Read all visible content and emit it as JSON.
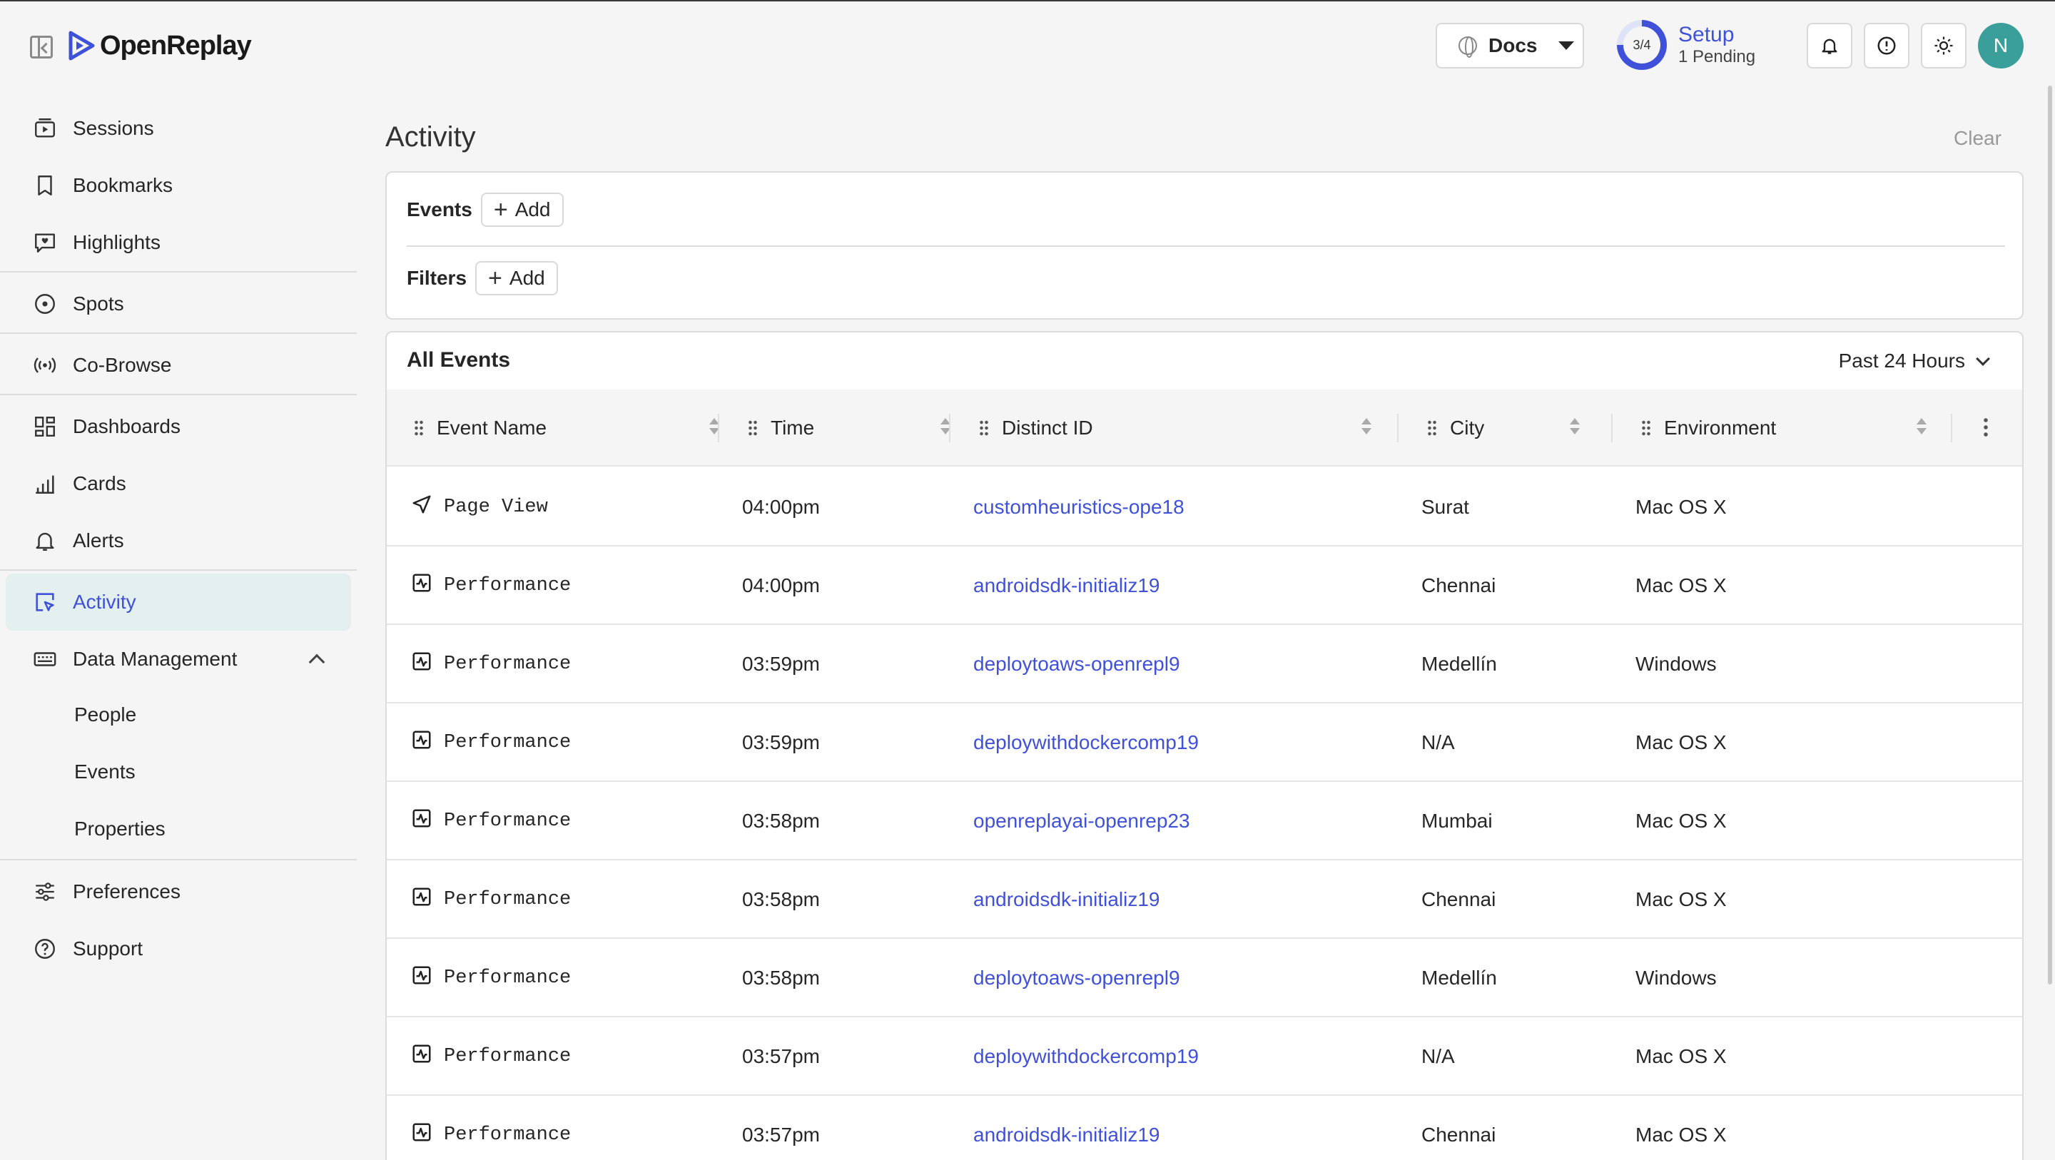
{
  "app": {
    "logo_text": "OpenReplay"
  },
  "topbar": {
    "docs_label": "Docs",
    "setup": {
      "progress_label": "3/4",
      "progress_fraction": 0.75,
      "title": "Setup",
      "pending": "1 Pending"
    },
    "avatar_initial": "N"
  },
  "sidebar": {
    "items": [
      {
        "label": "Sessions",
        "icon": "sessions-icon"
      },
      {
        "label": "Bookmarks",
        "icon": "bookmark-icon"
      },
      {
        "label": "Highlights",
        "icon": "highlights-icon"
      },
      {
        "label": "Spots",
        "icon": "spots-icon"
      },
      {
        "label": "Co-Browse",
        "icon": "broadcast-icon"
      },
      {
        "label": "Dashboards",
        "icon": "dashboard-icon"
      },
      {
        "label": "Cards",
        "icon": "bar-chart-icon"
      },
      {
        "label": "Alerts",
        "icon": "bell-icon"
      },
      {
        "label": "Activity",
        "icon": "cursor-icon",
        "active": true
      },
      {
        "label": "Data Management",
        "icon": "keyboard-icon"
      },
      {
        "label": "Preferences",
        "icon": "sliders-icon"
      },
      {
        "label": "Support",
        "icon": "help-icon"
      }
    ],
    "data_management_children": [
      "People",
      "Events",
      "Properties"
    ]
  },
  "main": {
    "title": "Activity",
    "clear_label": "Clear",
    "filters": {
      "events_label": "Events",
      "filters_label": "Filters",
      "add_label": "Add"
    },
    "events": {
      "title": "All Events",
      "range_label": "Past 24 Hours",
      "columns": [
        "Event Name",
        "Time",
        "Distinct ID",
        "City",
        "Environment"
      ],
      "rows": [
        {
          "event": "Page View",
          "icon": "navigation-icon",
          "time": "04:00pm",
          "id": "customheuristics-ope18",
          "city": "Surat",
          "env": "Mac OS X"
        },
        {
          "event": "Performance",
          "icon": "performance-icon",
          "time": "04:00pm",
          "id": "androidsdk-initializ19",
          "city": "Chennai",
          "env": "Mac OS X"
        },
        {
          "event": "Performance",
          "icon": "performance-icon",
          "time": "03:59pm",
          "id": "deploytoaws-openrepl9",
          "city": "Medellín",
          "env": "Windows"
        },
        {
          "event": "Performance",
          "icon": "performance-icon",
          "time": "03:59pm",
          "id": "deploywithdockercomp19",
          "city": "N/A",
          "env": "Mac OS X"
        },
        {
          "event": "Performance",
          "icon": "performance-icon",
          "time": "03:58pm",
          "id": "openreplayai-openrep23",
          "city": "Mumbai",
          "env": "Mac OS X"
        },
        {
          "event": "Performance",
          "icon": "performance-icon",
          "time": "03:58pm",
          "id": "androidsdk-initializ19",
          "city": "Chennai",
          "env": "Mac OS X"
        },
        {
          "event": "Performance",
          "icon": "performance-icon",
          "time": "03:58pm",
          "id": "deploytoaws-openrepl9",
          "city": "Medellín",
          "env": "Windows"
        },
        {
          "event": "Performance",
          "icon": "performance-icon",
          "time": "03:57pm",
          "id": "deploywithdockercomp19",
          "city": "N/A",
          "env": "Mac OS X"
        },
        {
          "event": "Performance",
          "icon": "performance-icon",
          "time": "03:57pm",
          "id": "androidsdk-initializ19",
          "city": "Chennai",
          "env": "Mac OS X"
        }
      ]
    }
  },
  "colors": {
    "accent": "#3f51d8",
    "active_bg": "#e4f0ef",
    "avatar": "#3a9e9a"
  }
}
